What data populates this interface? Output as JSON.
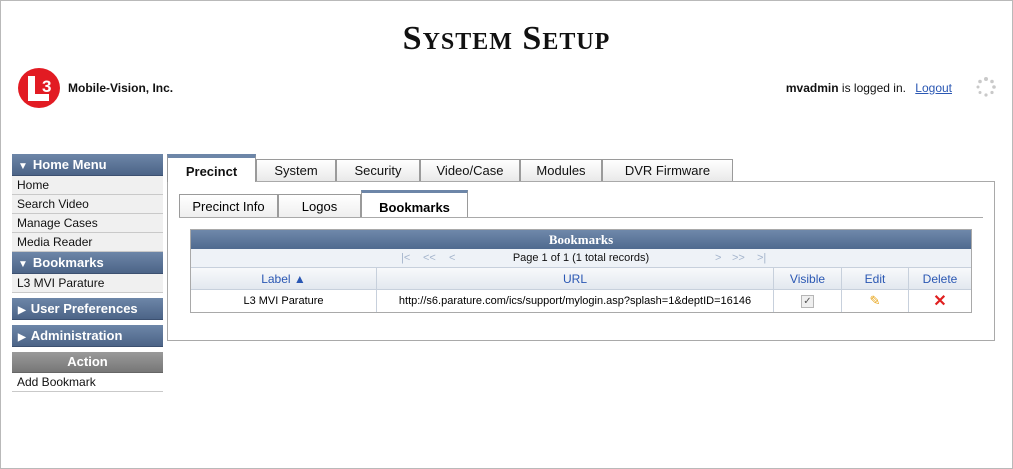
{
  "header": {
    "title": "System Setup",
    "company": "Mobile-Vision, Inc.",
    "logo_text": "3",
    "user": "mvadmin",
    "logged_in_text": "is logged in.",
    "logout": "Logout"
  },
  "sidebar": {
    "home_menu": {
      "label": "Home Menu",
      "items": [
        "Home",
        "Search Video",
        "Manage Cases",
        "Media Reader"
      ]
    },
    "bookmarks": {
      "label": "Bookmarks",
      "items": [
        "L3 MVI Parature"
      ]
    },
    "user_preferences": "User Preferences",
    "administration": "Administration",
    "action": {
      "label": "Action",
      "items": [
        "Add Bookmark"
      ]
    }
  },
  "tabs": [
    "Precinct",
    "System",
    "Security",
    "Video/Case",
    "Modules",
    "DVR Firmware"
  ],
  "active_tab": "Precinct",
  "subtabs": [
    "Precinct Info",
    "Logos",
    "Bookmarks"
  ],
  "active_subtab": "Bookmarks",
  "grid": {
    "title": "Bookmarks",
    "pager_text": "Page 1 of 1 (1 total records)",
    "columns": [
      "Label ▲",
      "URL",
      "Visible",
      "Edit",
      "Delete"
    ],
    "rows": [
      {
        "label": "L3 MVI Parature",
        "url": "http://s6.parature.com/ics/support/mylogin.asp?splash=1&deptID=16146",
        "visible": true
      }
    ]
  },
  "colors": {
    "menu_head": "#5a7398",
    "link": "#2a57b3",
    "delete": "#e02020",
    "edit": "#e8a51a"
  }
}
